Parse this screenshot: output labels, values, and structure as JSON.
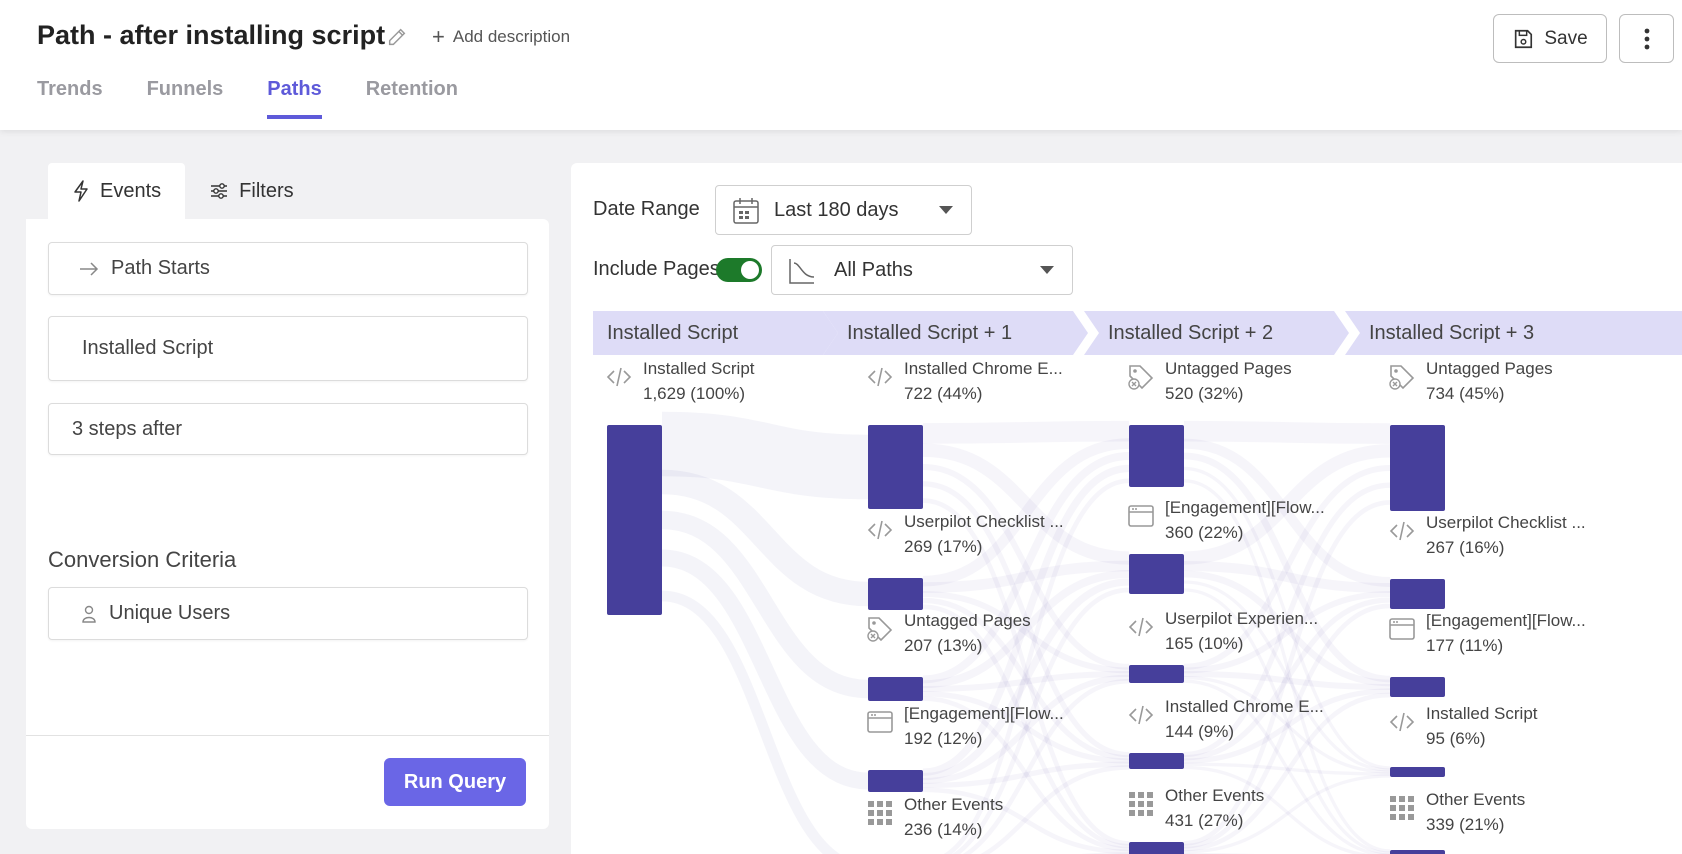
{
  "header": {
    "title": "Path - after installing script",
    "add_description": "Add description",
    "save_label": "Save",
    "tabs": [
      {
        "label": "Trends",
        "active": false
      },
      {
        "label": "Funnels",
        "active": false
      },
      {
        "label": "Paths",
        "active": true
      },
      {
        "label": "Retention",
        "active": false
      }
    ]
  },
  "left_panel": {
    "tabs": [
      {
        "label": "Events",
        "icon": "bolt-icon",
        "active": true
      },
      {
        "label": "Filters",
        "icon": "sliders-icon",
        "active": false
      }
    ],
    "path_starts": "Path Starts",
    "event": "Installed Script",
    "steps_after": "3 steps after",
    "conversion_title": "Conversion Criteria",
    "conversion_value": "Unique Users",
    "run_query": "Run Query"
  },
  "right_panel": {
    "date_range_label": "Date Range",
    "date_range_value": "Last 180 days",
    "include_pages_label": "Include Pages",
    "include_pages_on": true,
    "paths_value": "All Paths",
    "accent_color": "#463f9b",
    "header_color": "#dedcf7",
    "steps": [
      {
        "label": "Installed Script",
        "nodes": [
          {
            "name": "Installed Script",
            "value": "1,629 (100%)",
            "icon": "code-icon",
            "share": 1.0
          }
        ]
      },
      {
        "label": "Installed Script + 1",
        "nodes": [
          {
            "name": "Installed Chrome E...",
            "value": "722 (44%)",
            "icon": "code-icon",
            "share": 0.44
          },
          {
            "name": "Userpilot Checklist ...",
            "value": "269 (17%)",
            "icon": "code-icon",
            "share": 0.17
          },
          {
            "name": "Untagged Pages",
            "value": "207 (13%)",
            "icon": "tag-icon",
            "share": 0.13
          },
          {
            "name": "[Engagement][Flow...",
            "value": "192 (12%)",
            "icon": "window-icon",
            "share": 0.12
          },
          {
            "name": "Other Events",
            "value": "236 (14%)",
            "icon": "grid-icon",
            "share": 0.14
          }
        ]
      },
      {
        "label": "Installed Script + 2",
        "nodes": [
          {
            "name": "Untagged Pages",
            "value": "520 (32%)",
            "icon": "tag-icon",
            "share": 0.32
          },
          {
            "name": "[Engagement][Flow...",
            "value": "360 (22%)",
            "icon": "window-icon",
            "share": 0.22
          },
          {
            "name": "Userpilot Experien...",
            "value": "165 (10%)",
            "icon": "code-icon",
            "share": 0.1
          },
          {
            "name": "Installed Chrome E...",
            "value": "144 (9%)",
            "icon": "code-icon",
            "share": 0.09
          },
          {
            "name": "Other Events",
            "value": "431 (27%)",
            "icon": "grid-icon",
            "share": 0.27
          }
        ]
      },
      {
        "label": "Installed Script + 3",
        "nodes": [
          {
            "name": "Untagged Pages",
            "value": "734 (45%)",
            "icon": "tag-icon",
            "share": 0.45
          },
          {
            "name": "Userpilot Checklist ...",
            "value": "267 (16%)",
            "icon": "code-icon",
            "share": 0.16
          },
          {
            "name": "[Engagement][Flow...",
            "value": "177 (11%)",
            "icon": "window-icon",
            "share": 0.11
          },
          {
            "name": "Installed Script",
            "value": "95 (6%)",
            "icon": "code-icon",
            "share": 0.06
          },
          {
            "name": "Other Events",
            "value": "339 (21%)",
            "icon": "grid-icon",
            "share": 0.21
          }
        ]
      }
    ]
  }
}
